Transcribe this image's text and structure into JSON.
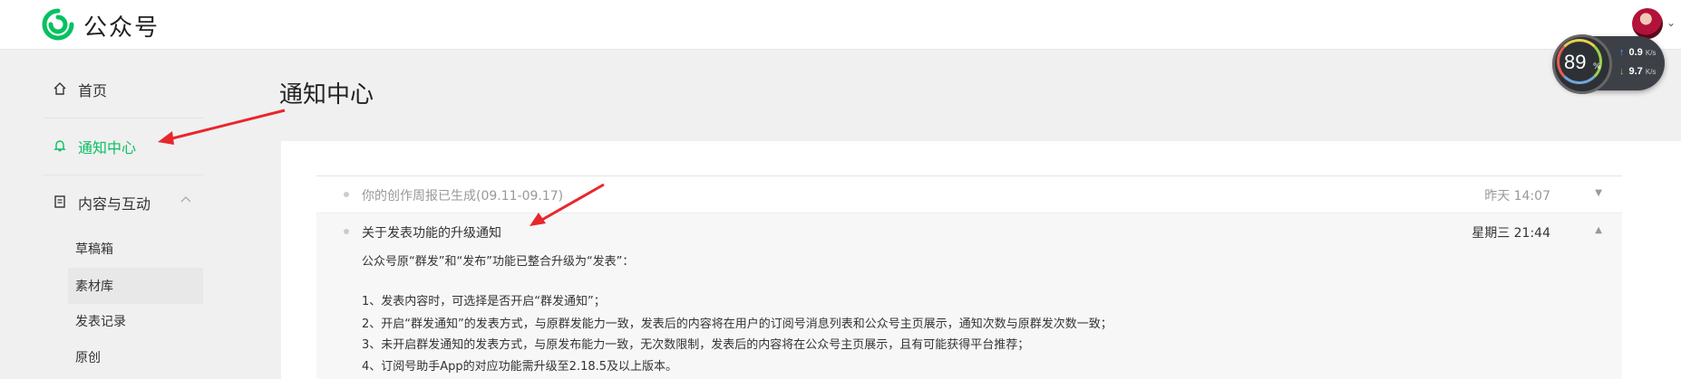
{
  "header": {
    "logo_text": "公众号",
    "brand_color": "#07c160",
    "avatar_icon": "user-avatar"
  },
  "system_monitor": {
    "cpu_percent_value": "89",
    "cpu_percent_unit": "%",
    "upload_speed": "0.9",
    "upload_unit": "K/s",
    "download_speed": "9.7",
    "download_unit": "K/s"
  },
  "sidebar": {
    "home": {
      "label": "首页",
      "icon": "home-icon"
    },
    "notifications": {
      "label": "通知中心",
      "icon": "bell-icon",
      "active": true
    },
    "content": {
      "label": "内容与互动",
      "icon": "document-icon",
      "expanded": true,
      "children": [
        {
          "label": "草稿箱"
        },
        {
          "label": "素材库"
        },
        {
          "label": "发表记录"
        },
        {
          "label": "原创"
        }
      ]
    }
  },
  "page": {
    "title": "通知中心"
  },
  "notices": [
    {
      "title": "你的创作周报已生成(09.11-09.17)",
      "time": "昨天 14:07",
      "expanded": false
    },
    {
      "title": "关于发表功能的升级通知",
      "time": "星期三 21:44",
      "expanded": true,
      "body": [
        "公众号原“群发”和“发布”功能已整合升级为“发表”：",
        "1、发表内容时，可选择是否开启“群发通知”；",
        "2、开启“群发通知”的发表方式，与原群发能力一致，发表后的内容将在用户的订阅号消息列表和公众号主页展示，通知次数与原群发次数一致；",
        "3、未开启群发通知的发表方式，与原发布能力一致，无次数限制，发表后的内容将在公众号主页展示，且有可能获得平台推荐；",
        "4、订阅号助手App的对应功能需升级至2.18.5及以上版本。"
      ]
    }
  ]
}
